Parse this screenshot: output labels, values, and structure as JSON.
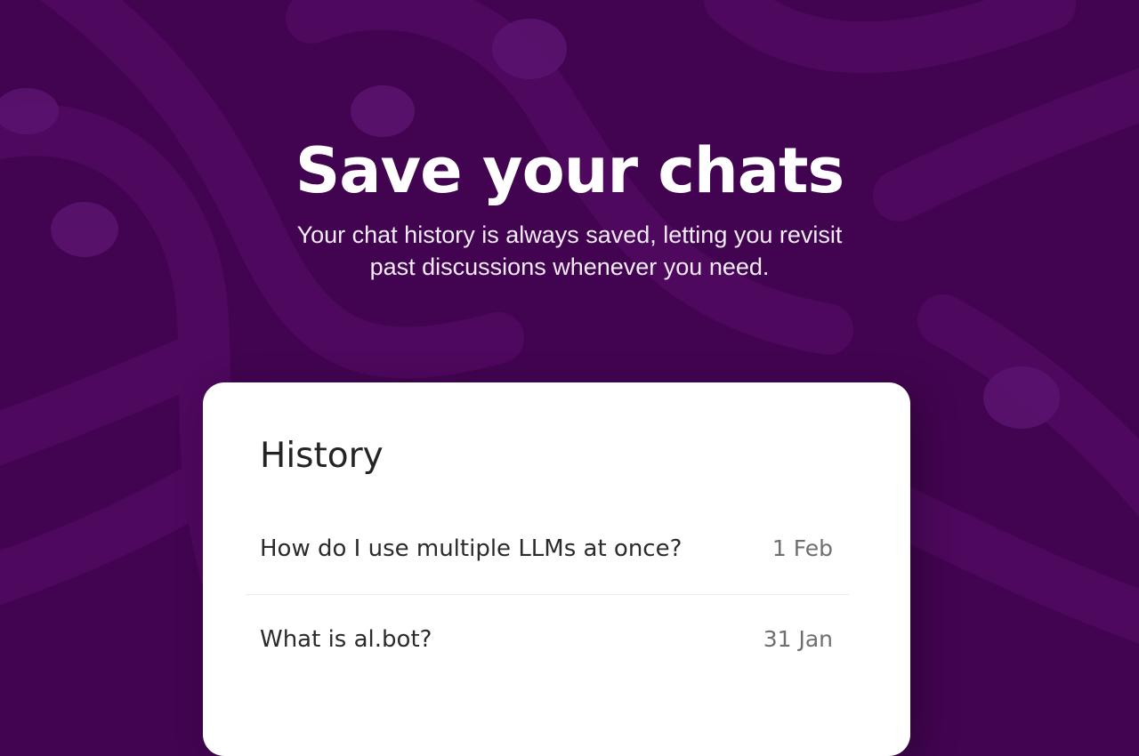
{
  "hero": {
    "title": "Save your chats",
    "subtitle": "Your chat history is always saved, letting you revisit past discussions whenever you need."
  },
  "history": {
    "title": "History",
    "items": [
      {
        "title": "How do I use multiple LLMs at once?",
        "date": "1 Feb"
      },
      {
        "title": "What is al.bot?",
        "date": "31 Jan"
      }
    ]
  },
  "colors": {
    "background": "#420451",
    "pattern": "#530a63",
    "card": "#ffffff"
  }
}
